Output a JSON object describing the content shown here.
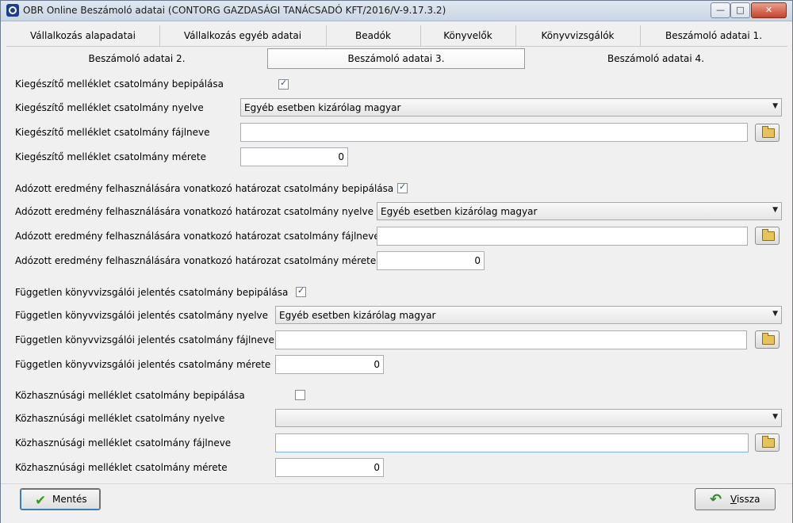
{
  "window": {
    "title": "OBR Online Beszámoló adatai (CONTORG GAZDASÁGI TANÁCSADÓ KFT/2016/V-9.17.3.2)"
  },
  "tabs_row1": [
    "Vállalkozás alapadatai",
    "Vállalkozás egyéb adatai",
    "Beadók",
    "Könyvelők",
    "Könyvvizsgálók",
    "Beszámoló adatai 1."
  ],
  "tabs_row2": [
    "Beszámoló adatai 2.",
    "Beszámoló adatai 3.",
    "Beszámoló adatai 4."
  ],
  "active_tab": "Beszámoló adatai 3.",
  "sections": {
    "s1": {
      "embed_label": "Kiegészítő melléklet csatolmány bepipálása",
      "embed_checked": true,
      "lang_label": "Kiegészítő melléklet csatolmány nyelve",
      "lang_value": "Egyéb esetben kizárólag magyar",
      "file_label": "Kiegészítő melléklet csatolmány fájlneve",
      "file_value": "",
      "size_label": "Kiegészítő melléklet csatolmány mérete",
      "size_value": "0"
    },
    "s2": {
      "embed_label": "Adózott eredmény felhasználására vonatkozó határozat csatolmány bepipálása",
      "embed_checked": true,
      "lang_label": "Adózott eredmény felhasználására vonatkozó határozat csatolmány nyelve",
      "lang_value": "Egyéb esetben kizárólag magyar",
      "file_label": "Adózott eredmény felhasználására vonatkozó határozat csatolmány fájlneve",
      "file_value": "",
      "size_label": "Adózott eredmény felhasználására vonatkozó határozat csatolmány mérete",
      "size_value": "0"
    },
    "s3": {
      "embed_label": "Független könyvvizsgálói jelentés csatolmány bepipálása",
      "embed_checked": true,
      "lang_label": "Független könyvvizsgálói jelentés csatolmány nyelve",
      "lang_value": "Egyéb esetben kizárólag magyar",
      "file_label": "Független könyvvizsgálói jelentés csatolmány fájlneve",
      "file_value": "",
      "size_label": "Független könyvvizsgálói jelentés csatolmány mérete",
      "size_value": "0"
    },
    "s4": {
      "embed_label": "Közhasznúsági melléklet csatolmány bepipálása",
      "embed_checked": false,
      "lang_label": "Közhasznúsági melléklet csatolmány nyelve",
      "lang_value": "",
      "file_label": "Közhasznúsági melléklet csatolmány fájlneve",
      "file_value": "",
      "size_label": "Közhasznúsági melléklet csatolmány mérete",
      "size_value": "0"
    }
  },
  "buttons": {
    "save": "Mentés",
    "back": "Vissza"
  },
  "icons": {
    "save": "checkmark-icon",
    "back": "back-arrow-icon",
    "browse": "folder-open-icon"
  }
}
